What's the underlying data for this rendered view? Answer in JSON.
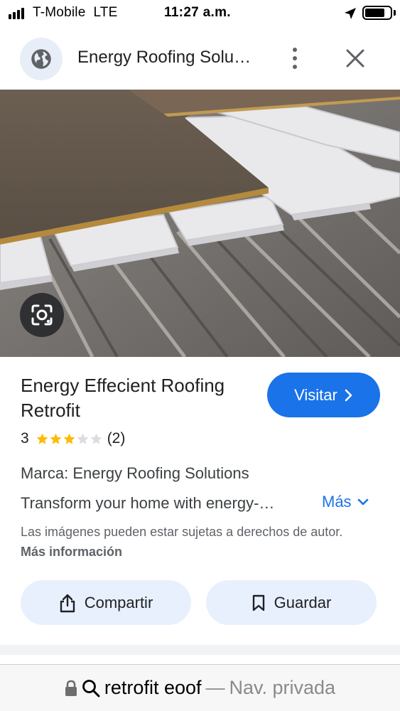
{
  "status_bar": {
    "carrier": "T-Mobile",
    "network": "LTE",
    "time": "11:27 a.m."
  },
  "header": {
    "title": "Energy Roofing Solu…",
    "icons": [
      "globe-icon",
      "more-vert-icon",
      "close-icon"
    ]
  },
  "product": {
    "title": "Energy Effecient Roofing Retrofit",
    "visit_label": "Visitar",
    "rating_value": "3",
    "rating_stars": 3,
    "rating_max": 5,
    "rating_count": "(2)",
    "brand": "Marca: Energy Roofing Solutions",
    "description": "Transform your home with energy-…",
    "more_label": "Más",
    "copyright_text": "Las imágenes pueden estar sujetas a derechos de autor.",
    "more_info_label": "Más información"
  },
  "actions": {
    "share_label": "Compartir",
    "save_label": "Guardar"
  },
  "url_bar": {
    "query": "retrofit eoof",
    "separator": "—",
    "mode": "Nav. privada"
  },
  "colors": {
    "accent": "#1a73e8",
    "star_filled": "#fbbc04",
    "star_empty": "#dadce0",
    "button_tonal": "#e8f0fe"
  }
}
